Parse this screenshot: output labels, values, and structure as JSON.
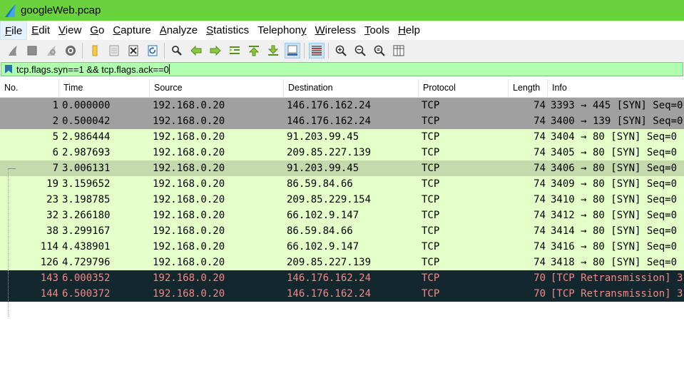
{
  "window": {
    "title": "googleWeb.pcap"
  },
  "menu": [
    {
      "pre": "",
      "ul": "F",
      "post": "ile"
    },
    {
      "pre": "",
      "ul": "E",
      "post": "dit"
    },
    {
      "pre": "",
      "ul": "V",
      "post": "iew"
    },
    {
      "pre": "",
      "ul": "G",
      "post": "o"
    },
    {
      "pre": "",
      "ul": "C",
      "post": "apture"
    },
    {
      "pre": "",
      "ul": "A",
      "post": "nalyze"
    },
    {
      "pre": "",
      "ul": "S",
      "post": "tatistics"
    },
    {
      "pre": "Telephon",
      "ul": "y",
      "post": ""
    },
    {
      "pre": "",
      "ul": "W",
      "post": "ireless"
    },
    {
      "pre": "",
      "ul": "T",
      "post": "ools"
    },
    {
      "pre": "",
      "ul": "H",
      "post": "elp"
    }
  ],
  "filter": {
    "value": "tcp.flags.syn==1 && tcp.flags.ack==0"
  },
  "columns": [
    "No.",
    "Time",
    "Source",
    "Destination",
    "Protocol",
    "Length",
    "Info"
  ],
  "packets": [
    {
      "no": "1",
      "time": "0.000000",
      "src": "192.168.0.20",
      "dst": "146.176.162.24",
      "proto": "TCP",
      "len": "74",
      "info": "3393 → 445 [SYN] Seq=0",
      "style": "gray"
    },
    {
      "no": "2",
      "time": "0.500042",
      "src": "192.168.0.20",
      "dst": "146.176.162.24",
      "proto": "TCP",
      "len": "74",
      "info": "3400 → 139 [SYN] Seq=0",
      "style": "gray"
    },
    {
      "no": "5",
      "time": "2.986444",
      "src": "192.168.0.20",
      "dst": "91.203.99.45",
      "proto": "TCP",
      "len": "74",
      "info": "3404 → 80 [SYN] Seq=0",
      "style": "green"
    },
    {
      "no": "6",
      "time": "2.987693",
      "src": "192.168.0.20",
      "dst": "209.85.227.139",
      "proto": "TCP",
      "len": "74",
      "info": "3405 → 80 [SYN] Seq=0",
      "style": "green"
    },
    {
      "no": "7",
      "time": "3.006131",
      "src": "192.168.0.20",
      "dst": "91.203.99.45",
      "proto": "TCP",
      "len": "74",
      "info": "3406 → 80 [SYN] Seq=0",
      "style": "selected"
    },
    {
      "no": "19",
      "time": "3.159652",
      "src": "192.168.0.20",
      "dst": "86.59.84.66",
      "proto": "TCP",
      "len": "74",
      "info": "3409 → 80 [SYN] Seq=0",
      "style": "green"
    },
    {
      "no": "23",
      "time": "3.198785",
      "src": "192.168.0.20",
      "dst": "209.85.229.154",
      "proto": "TCP",
      "len": "74",
      "info": "3410 → 80 [SYN] Seq=0",
      "style": "green"
    },
    {
      "no": "32",
      "time": "3.266180",
      "src": "192.168.0.20",
      "dst": "66.102.9.147",
      "proto": "TCP",
      "len": "74",
      "info": "3412 → 80 [SYN] Seq=0",
      "style": "green"
    },
    {
      "no": "38",
      "time": "3.299167",
      "src": "192.168.0.20",
      "dst": "86.59.84.66",
      "proto": "TCP",
      "len": "74",
      "info": "3414 → 80 [SYN] Seq=0",
      "style": "green"
    },
    {
      "no": "114",
      "time": "4.438901",
      "src": "192.168.0.20",
      "dst": "66.102.9.147",
      "proto": "TCP",
      "len": "74",
      "info": "3416 → 80 [SYN] Seq=0",
      "style": "green"
    },
    {
      "no": "126",
      "time": "4.729796",
      "src": "192.168.0.20",
      "dst": "209.85.227.139",
      "proto": "TCP",
      "len": "74",
      "info": "3418 → 80 [SYN] Seq=0",
      "style": "green"
    },
    {
      "no": "143",
      "time": "6.000352",
      "src": "192.168.0.20",
      "dst": "146.176.162.24",
      "proto": "TCP",
      "len": "70",
      "info": "[TCP Retransmission] 3",
      "style": "bad"
    },
    {
      "no": "144",
      "time": "6.500372",
      "src": "192.168.0.20",
      "dst": "146.176.162.24",
      "proto": "TCP",
      "len": "70",
      "info": "[TCP Retransmission] 3",
      "style": "bad"
    }
  ],
  "colors": {
    "titlebar": "#6ad23c",
    "filter_valid": "#afffaf",
    "row_gray_bg": "#a0a0a0",
    "row_green_bg": "#e4ffc7",
    "row_selected_bg": "#c4d9ac",
    "row_bad_bg": "#12272e",
    "row_bad_fg": "#f78787"
  },
  "toolbar_icons": [
    "start-capture-icon",
    "stop-capture-icon",
    "restart-capture-icon",
    "capture-options-icon",
    "open-file-icon",
    "save-file-icon",
    "close-file-icon",
    "reload-file-icon",
    "find-packet-icon",
    "go-back-icon",
    "go-forward-icon",
    "go-to-packet-icon",
    "go-first-icon",
    "go-last-icon",
    "autoscroll-icon",
    "colorize-icon",
    "zoom-in-icon",
    "zoom-out-icon",
    "zoom-normal-icon",
    "resize-columns-icon"
  ]
}
